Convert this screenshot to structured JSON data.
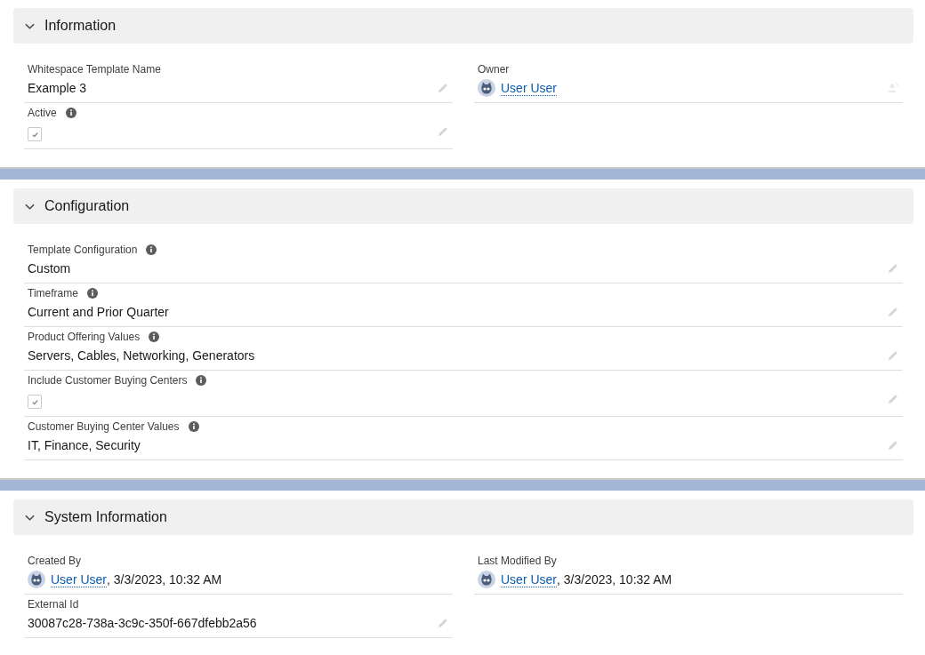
{
  "sections": [
    {
      "title": "Information",
      "expanded": true,
      "columns": [
        [
          {
            "label": "Whitespace Template Name",
            "info": false,
            "kind": "text",
            "value": "Example 3",
            "editable": true
          },
          {
            "label": "Active",
            "info": true,
            "kind": "checkbox",
            "checked": true,
            "editable": true
          }
        ],
        [
          {
            "label": "Owner",
            "info": false,
            "kind": "user",
            "user": "User User",
            "reassignable": true
          }
        ]
      ]
    },
    {
      "title": "Configuration",
      "expanded": true,
      "columns": [
        [
          {
            "label": "Template Configuration",
            "info": true,
            "kind": "text",
            "value": "Custom",
            "editable": true
          },
          {
            "label": "Timeframe",
            "info": true,
            "kind": "text",
            "value": "Current and Prior Quarter",
            "editable": true
          },
          {
            "label": "Product Offering Values",
            "info": true,
            "kind": "text",
            "value": "Servers, Cables, Networking, Generators",
            "editable": true
          },
          {
            "label": "Include Customer Buying Centers",
            "info": true,
            "kind": "checkbox",
            "checked": true,
            "editable": true
          },
          {
            "label": "Customer Buying Center Values",
            "info": true,
            "kind": "text",
            "value": "IT, Finance, Security",
            "editable": true
          }
        ]
      ]
    },
    {
      "title": "System Information",
      "expanded": true,
      "columns": [
        [
          {
            "label": "Created By",
            "info": false,
            "kind": "user",
            "user": "User User",
            "suffix": ", 3/3/2023, 10:32 AM"
          },
          {
            "label": "External Id",
            "info": false,
            "kind": "text",
            "value": "30087c28-738a-3c9c-350f-667dfebb2a56",
            "editable": true
          }
        ],
        [
          {
            "label": "Last Modified By",
            "info": false,
            "kind": "user",
            "user": "User User",
            "suffix": ", 3/3/2023, 10:32 AM"
          }
        ]
      ]
    }
  ]
}
